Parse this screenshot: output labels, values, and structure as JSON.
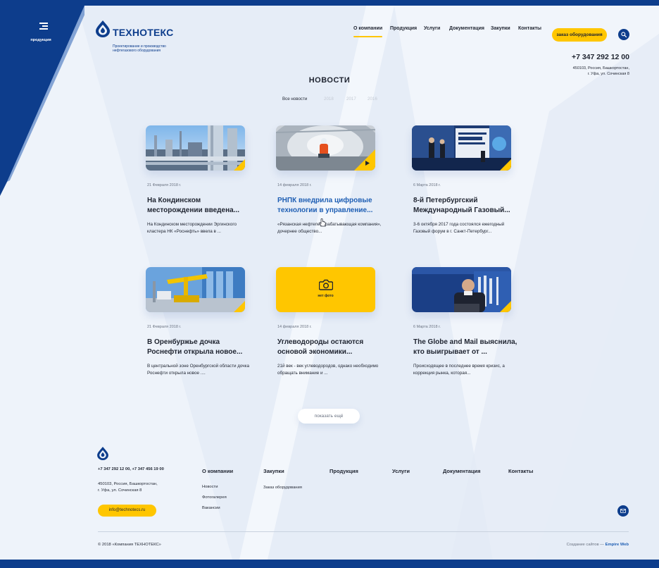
{
  "sidebar": {
    "products_label": "продукция"
  },
  "logo": {
    "brand": "ТЕХНОТЕКС",
    "tagline": "Проектирование и производство нефтегазового оборудования"
  },
  "nav": {
    "items": [
      {
        "label": "О компании",
        "active": true
      },
      {
        "label": "Продукция",
        "active": false
      },
      {
        "label": "Услуги",
        "active": false
      },
      {
        "label": "Документация",
        "active": false
      },
      {
        "label": "Закупки",
        "active": false
      },
      {
        "label": "Контакты",
        "active": false
      }
    ],
    "order_button": "заказ оборудования"
  },
  "contacts": {
    "phone": "+7 347 292 12 00",
    "address_line1": "450103, Россия, Башкортостан,",
    "address_line2": "г. Уфа, ул. Сочинская 8"
  },
  "news": {
    "title": "НОВОСТИ",
    "filters": [
      {
        "label": "Все новости",
        "active": true
      },
      {
        "label": "2018",
        "active": false
      },
      {
        "label": "2017",
        "active": false
      },
      {
        "label": "2016",
        "active": false
      }
    ],
    "items": [
      {
        "date": "21 Февраля 2018 г.",
        "title": "На Кондинском месторождении введена...",
        "excerpt": "На Кондинском месторождении Эргинского кластера НК «Роснефть» ввела в ...",
        "image": "refinery-photo",
        "video": false,
        "photo": true
      },
      {
        "date": "14 февраля 2018 г.",
        "title": "РНПК внедрила цифровые технологии в управление...",
        "excerpt": "«Рязанская нефтеперерабатывающая компания», дочернее общество...",
        "image": "pipe-worker-photo",
        "video": true,
        "photo": true
      },
      {
        "date": "6 Марта 2018 г.",
        "title": "8-й Петербургский Международный Газовый...",
        "excerpt": "3-6 октября 2017 года состоялся ежегодный Газовый форум в г. Санкт-Петербург...",
        "image": "gas-forum-photo",
        "video": false,
        "photo": true
      },
      {
        "date": "21 Февраля 2018 г.",
        "title": "В Оренбуржье дочка Роснефти открыла новое...",
        "excerpt": "В центральной зоне Оренбургской области дочка Роснефти открыла новое ....",
        "image": "pumpjack-photo",
        "video": false,
        "photo": true
      },
      {
        "date": "14 февраля 2018 г.",
        "title": "Углеводороды остаются основой экономики...",
        "excerpt": "21й век - век углеводородов, однако необходимо обращать внимание и ...",
        "image": "",
        "video": false,
        "photo": false,
        "no_photo_label": "нет фото"
      },
      {
        "date": "6 Марта 2018 г.",
        "title": "The Globe and Mail выяснила, кто выигрывает от ...",
        "excerpt": "Происходящее в последнее время  кризис, а коррекция рынка, которая...",
        "image": "speaker-photo",
        "video": false,
        "photo": true
      }
    ],
    "more_button": "показать ещё"
  },
  "footer": {
    "phones": "+7 347 292 12 00, +7 347 456 19 00",
    "address_line1": "450103, Россия, Башкортостан,",
    "address_line2": "г. Уфа, ул. Сочинская 8",
    "email": "info@technotecs.ru",
    "columns": {
      "about": {
        "title": "О компании",
        "links": [
          "Новости",
          "Фотогалерея",
          "Вакансии"
        ]
      },
      "purchases": {
        "title": "Закупки",
        "links": [
          "Заказ оборудования"
        ]
      },
      "products": {
        "title": "Продукция"
      },
      "services": {
        "title": "Услуги"
      },
      "docs": {
        "title": "Документация"
      },
      "contacts": {
        "title": "Контакты"
      }
    },
    "copyright": "© 2018  «Компания ТЕХНОТЕКС»",
    "developer_prefix": "Создание сайтов — ",
    "developer_name": "Empire Web"
  },
  "colors": {
    "brand_blue": "#0d3d8c",
    "accent_yellow": "#ffc600",
    "link_blue": "#1f5fb4"
  }
}
